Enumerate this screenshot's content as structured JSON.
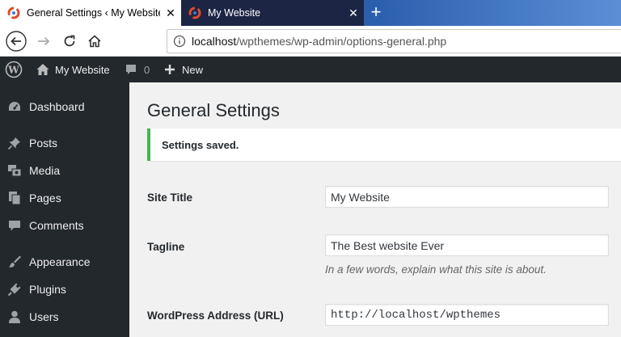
{
  "browser": {
    "tabs": [
      {
        "title": "General Settings ‹ My Website —",
        "active": true
      },
      {
        "title": "My Website",
        "active": false
      }
    ],
    "close_glyph": "✕",
    "new_tab_glyph": "+",
    "url_host": "localhost",
    "url_path": "/wpthemes/wp-admin/options-general.php"
  },
  "adminbar": {
    "site_name": "My Website",
    "comments_count": "0",
    "new_label": "New"
  },
  "sidebar": {
    "items": [
      {
        "label": "Dashboard",
        "icon": "dashboard-icon"
      },
      {
        "label": "Posts",
        "icon": "pin-icon"
      },
      {
        "label": "Media",
        "icon": "media-icon"
      },
      {
        "label": "Pages",
        "icon": "pages-icon"
      },
      {
        "label": "Comments",
        "icon": "comment-icon"
      },
      {
        "label": "Appearance",
        "icon": "brush-icon"
      },
      {
        "label": "Plugins",
        "icon": "plug-icon"
      },
      {
        "label": "Users",
        "icon": "user-icon"
      }
    ]
  },
  "main": {
    "title": "General Settings",
    "notice": "Settings saved.",
    "fields": [
      {
        "label": "Site Title",
        "value": "My Website"
      },
      {
        "label": "Tagline",
        "value": "The Best website Ever",
        "description": "In a few words, explain what this site is about."
      },
      {
        "label": "WordPress Address (URL)",
        "value": "http://localhost/wpthemes"
      }
    ]
  },
  "colors": {
    "admin_dark": "#23282d",
    "notice_success": "#46b450",
    "background": "#f1f1f1"
  }
}
